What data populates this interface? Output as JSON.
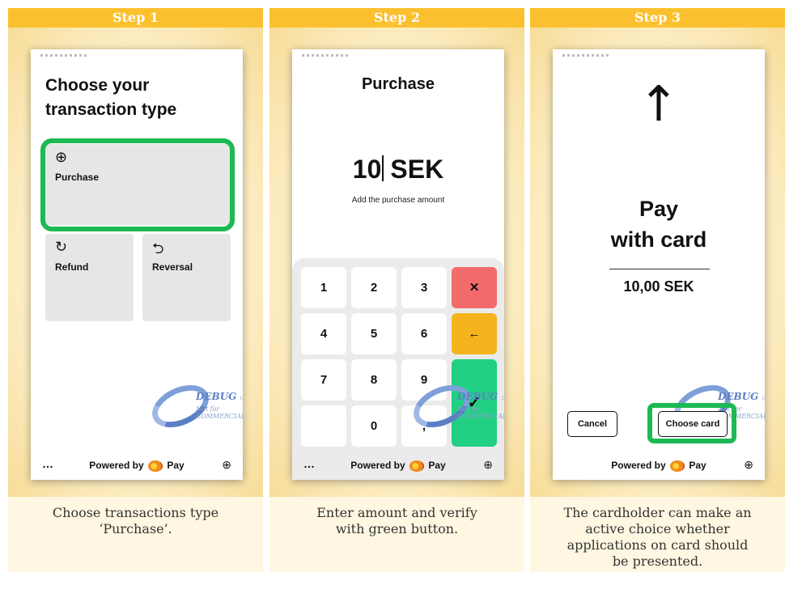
{
  "steps": [
    {
      "header": "Step 1",
      "caption_lines": [
        "Choose transactions type",
        "‘Purchase’."
      ]
    },
    {
      "header": "Step 2",
      "caption_lines": [
        "Enter amount and verify",
        "with green button."
      ]
    },
    {
      "header": "Step 3",
      "caption_lines": [
        "The cardholder can make an",
        "active choice whether",
        "applications on card should",
        "be presented."
      ]
    }
  ],
  "screen1": {
    "title_lines": [
      "Choose your",
      "transaction type"
    ],
    "tiles": [
      {
        "label": "Purchase",
        "icon": "⊕",
        "icon_name": "plus-circle-icon"
      },
      {
        "label": "Refund",
        "icon": "↻",
        "icon_name": "refresh-icon"
      },
      {
        "label": "Reversal",
        "icon": "⮌",
        "icon_name": "reversal-icon"
      }
    ]
  },
  "screen2": {
    "title": "Purchase",
    "amount_value": "10",
    "currency": "SEK",
    "hint": "Add the purchase amount",
    "keys": [
      "1",
      "2",
      "3",
      "4",
      "5",
      "6",
      "7",
      "8",
      "9",
      "0",
      ","
    ],
    "clear_key": "✕",
    "back_key": "←",
    "ok_key": "✓"
  },
  "screen3": {
    "arrow": "↑",
    "pay_lines": [
      "Pay",
      "with card"
    ],
    "amount": "10,00 SEK",
    "cancel_label": "Cancel",
    "choose_label": "Choose card"
  },
  "footer": {
    "dots": "…",
    "powered_by": "Powered by",
    "brand": "Pay",
    "globe": "⊕"
  },
  "watermark": {
    "line1": "DEBUG",
    "line1_small": "only",
    "line2": "Not for COMMERCIAL"
  },
  "colors": {
    "header": "#fbc02d",
    "highlight": "#1db954",
    "key_red": "#f26b6b",
    "key_yellow": "#f5b41e",
    "key_green": "#21d083"
  }
}
